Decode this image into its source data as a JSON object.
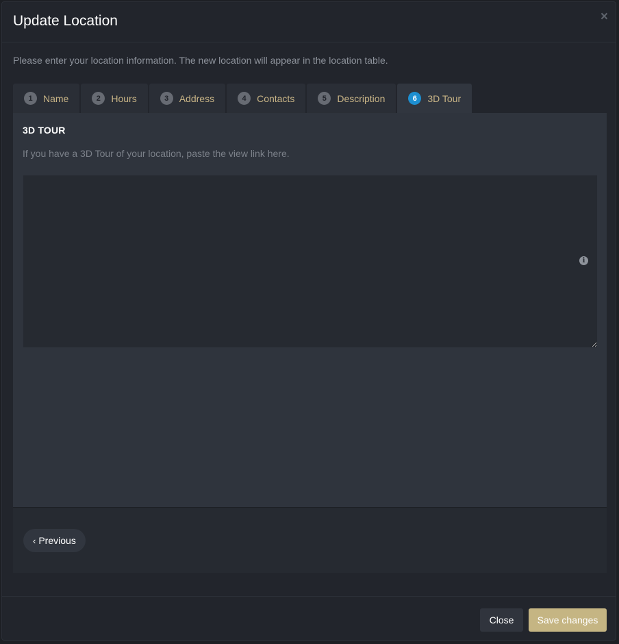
{
  "modal": {
    "title": "Update Location",
    "close_glyph": "×",
    "intro": "Please enter your location information. The new location will appear in the location table."
  },
  "tabs": [
    {
      "num": "1",
      "label": "Name",
      "active": false
    },
    {
      "num": "2",
      "label": "Hours",
      "active": false
    },
    {
      "num": "3",
      "label": "Address",
      "active": false
    },
    {
      "num": "4",
      "label": "Contacts",
      "active": false
    },
    {
      "num": "5",
      "label": "Description",
      "active": false
    },
    {
      "num": "6",
      "label": "3D Tour",
      "active": true
    }
  ],
  "tour": {
    "section_title": "3D TOUR",
    "help_text": "If you have a 3D Tour of your location, paste the view link here.",
    "value": "",
    "info_icon": "info-icon",
    "info_glyph": "i"
  },
  "nav": {
    "previous_chevron": "‹",
    "previous_label": "Previous"
  },
  "footer": {
    "close_label": "Close",
    "save_label": "Save changes"
  },
  "colors": {
    "accent": "#c5b583",
    "active_tab_badge": "#1d8fd1",
    "tab_label": "#c8b486"
  }
}
